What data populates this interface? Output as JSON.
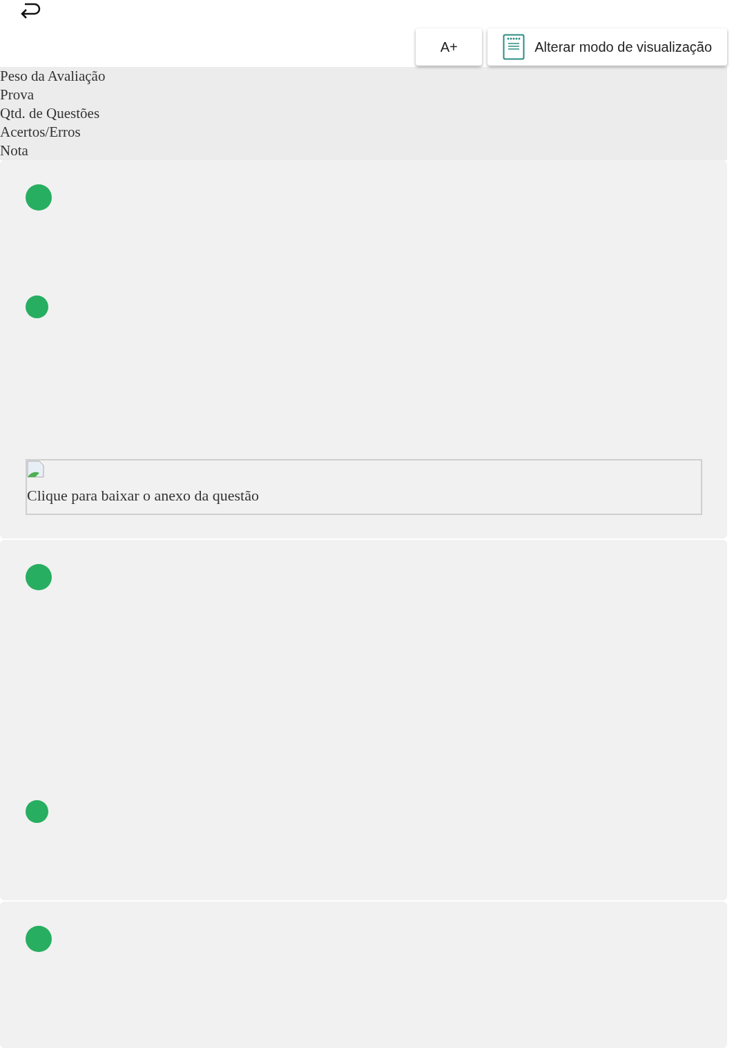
{
  "toolbar": {
    "buttons": [
      {
        "kind": "font",
        "label": "A+"
      },
      {
        "kind": "view",
        "label": "Alterar modo de visualização"
      }
    ]
  },
  "summary": {
    "labels": [
      "Peso da Avaliação",
      "Prova",
      "Qtd. de Questões",
      "Acertos/Erros",
      "Nota"
    ]
  },
  "questions": [
    {
      "markers": [
        {
          "kind": "large"
        },
        {
          "kind": "small"
        }
      ],
      "attachment": {
        "label": "Clique para baixar o anexo da questão"
      }
    },
    {
      "markers": [
        {
          "kind": "large"
        },
        {
          "kind": "small"
        }
      ]
    },
    {
      "markers": [
        {
          "kind": "large"
        }
      ]
    }
  ]
}
